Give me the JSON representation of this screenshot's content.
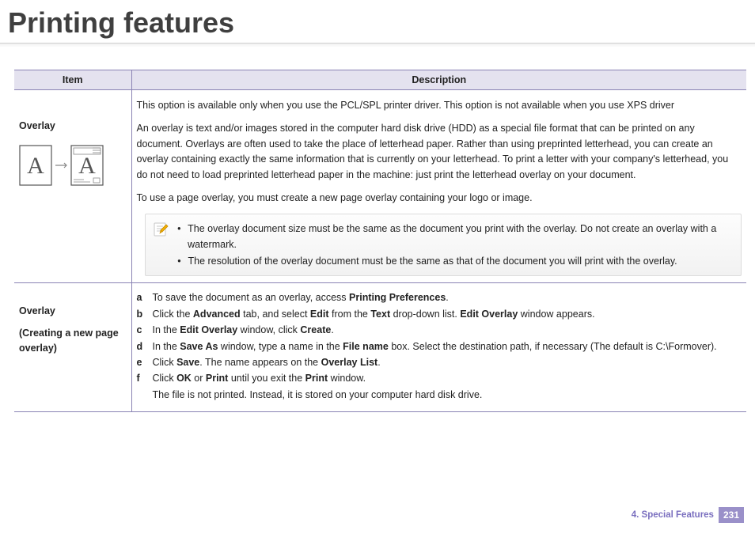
{
  "page_title": "Printing features",
  "headers": {
    "item": "Item",
    "desc": "Description"
  },
  "row1": {
    "item_label": "Overlay",
    "p1": "This option is available only when you use the PCL/SPL printer driver. This option is not available when you use XPS driver",
    "p2": "An overlay is text and/or images stored in the computer hard disk drive (HDD) as a special file format that can be printed on any document. Overlays are often used to take the place of letterhead paper. Rather than using preprinted letterhead, you can create an overlay containing exactly the same information that is currently on your letterhead. To print a letter with your company's letterhead, you do not need to load preprinted letterhead paper in the machine: just print the letterhead overlay on your document.",
    "p3": "To use a page overlay, you must create a new page overlay containing your logo or image.",
    "note1": "The overlay document size must be the same as the document you print with the overlay. Do not create an overlay with a watermark.",
    "note2": "The resolution of the overlay document must be the same as that of the document you will print with the overlay."
  },
  "row2": {
    "item_label": "Overlay",
    "item_sub": "(Creating a new page overlay)",
    "s_a_pre": "To save the document as an overlay, access ",
    "s_a_b1": "Printing Preferences",
    "s_a_post": ".",
    "s_b_pre": "Click the ",
    "s_b_b1": "Advanced",
    "s_b_mid1": " tab, and select ",
    "s_b_b2": "Edit",
    "s_b_mid2": " from the ",
    "s_b_b3": "Text",
    "s_b_mid3": " drop-down list. ",
    "s_b_b4": "Edit Overlay",
    "s_b_post": " window appears.",
    "s_c_pre": "In the ",
    "s_c_b1": "Edit Overlay",
    "s_c_mid1": " window, click ",
    "s_c_b2": "Create",
    "s_c_post": ".",
    "s_d_pre": "In the ",
    "s_d_b1": "Save As",
    "s_d_mid1": " window, type a name in the ",
    "s_d_b2": "File name",
    "s_d_post": " box. Select the destination path, if necessary (The default is C:\\Formover).",
    "s_e_pre": "Click ",
    "s_e_b1": "Save",
    "s_e_mid1": ". The name appears on the ",
    "s_e_b2": "Overlay List",
    "s_e_post": ".",
    "s_f_pre": "Click ",
    "s_f_b1": "OK",
    "s_f_mid1": " or ",
    "s_f_b2": "Print",
    "s_f_mid2": " until you exit the ",
    "s_f_b3": "Print",
    "s_f_post": " window.",
    "s_tail": "The file is not printed. Instead, it is stored on your computer hard disk drive."
  },
  "letters": {
    "a": "a",
    "b": "b",
    "c": "c",
    "d": "d",
    "e": "e",
    "f": "f"
  },
  "footer": {
    "chapter": "4.  Special Features",
    "page": "231"
  }
}
